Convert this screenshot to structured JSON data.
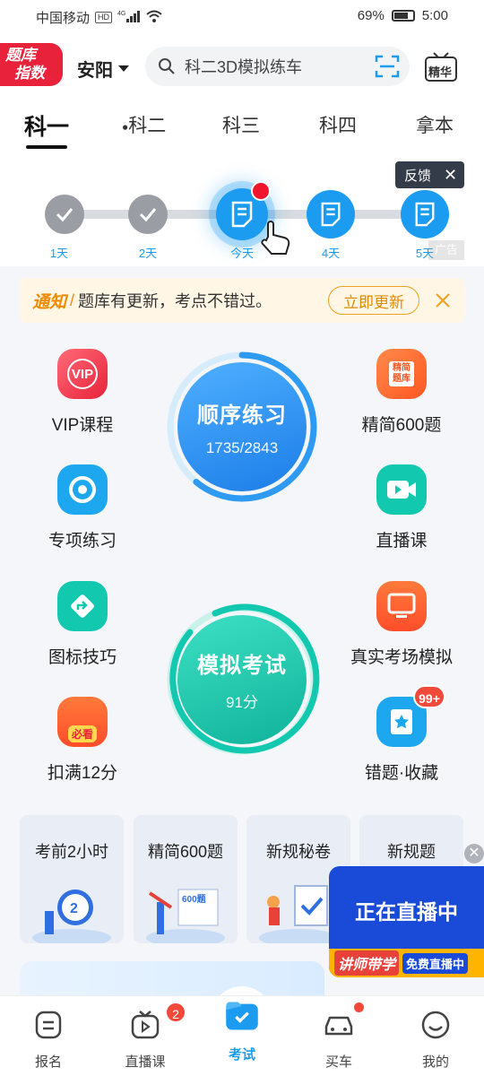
{
  "status_bar": {
    "carrier": "中国移动",
    "network": "4G",
    "hd": "HD",
    "battery": "69%",
    "time": "5:00"
  },
  "header": {
    "logo_line1": "题库",
    "logo_line2": "指数",
    "city": "安阳",
    "search_placeholder": "科二3D模拟练车",
    "jinghua_label": "精华"
  },
  "tabs": [
    "科一",
    "科二",
    "科三",
    "科四",
    "拿本"
  ],
  "progress": {
    "days": [
      "1天",
      "2天",
      "今天",
      "4天",
      "5天"
    ],
    "feedback_label": "反馈",
    "ad_label": "广告"
  },
  "notice": {
    "tag": "通知",
    "sep": "/",
    "text": "题库有更新，考点不错过。",
    "button": "立即更新"
  },
  "features": {
    "vip": "VIP课程",
    "jingjian600": "精简600题",
    "zhuanxiang": "专项练习",
    "zhibo": "直播课",
    "tubiao": "图标技巧",
    "zhenshi": "真实考场模拟",
    "kouman": "扣满12分",
    "cuoti": "错题·收藏",
    "cuoti_badge": "99+",
    "vip_icon_text": "VIP",
    "jingjian_icon_text": "精简题库",
    "kouman_icon_text": "必看"
  },
  "sequential": {
    "title": "顺序练习",
    "progress_text": "1735/2843",
    "progress_fraction": 0.61
  },
  "mock_exam": {
    "title": "模拟考试",
    "score": "91分"
  },
  "cards": [
    "考前2小时",
    "精简600题",
    "新规秘卷",
    "新规题"
  ],
  "card_icon_texts": {
    "timer": "2",
    "book": "600题"
  },
  "live_float": {
    "title": "正在直播中",
    "tag1": "讲师带学",
    "tag2": "免费直播中"
  },
  "bottom_nav": {
    "items": [
      "报名",
      "直播课",
      "考试",
      "买车",
      "我的"
    ],
    "live_badge": "2"
  },
  "colors": {
    "accent": "#1c9cf0",
    "brand_red": "#e8223a",
    "notice_orange": "#f08a00"
  }
}
